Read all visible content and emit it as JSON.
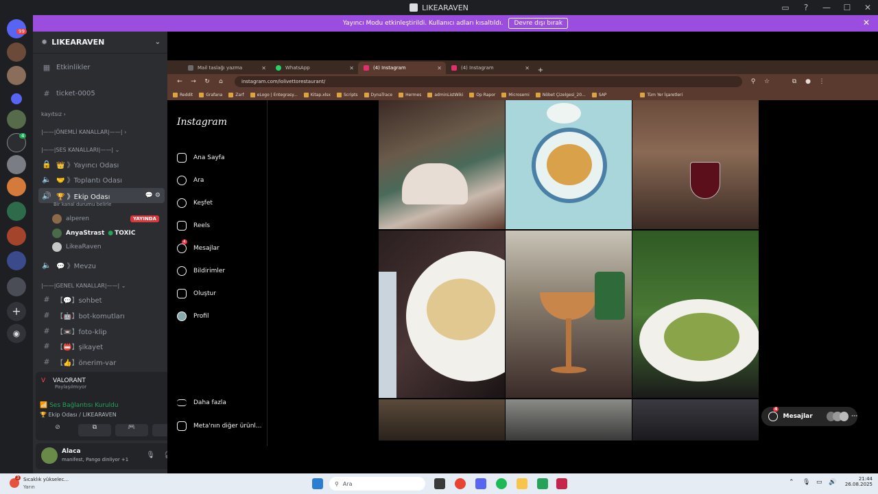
{
  "window": {
    "title": "LIKEARAVEN",
    "controls": [
      "—",
      "☐",
      "✕"
    ]
  },
  "stream_banner": {
    "text": "Yayıncı Modu etkinleştirildi. Kullanıcı adları kısaltıldı.",
    "button": "Devre dışı bırak"
  },
  "rail": {
    "home_badge": "99",
    "badge2": "4"
  },
  "sidebar": {
    "server_name": "LIKEARAVEN",
    "events": "Etkinlikler",
    "ticket": "ticket-0005",
    "kayitsiz": "kayıtsız",
    "cat_onemli": "|——|ÖNEMLİ KANALLAR|——|",
    "cat_ses": "|——|SES KANALLARI|——|",
    "yayinci": "👑 》Yayıncı Odası",
    "toplanti": "🤝 》Toplantı Odası",
    "ekip": "🏆 》Ekip Odası",
    "ekip_status": "Bir kanal durumu belirle",
    "users": [
      {
        "name": "alperen",
        "live": "YAYINDA"
      },
      {
        "name": "AnyaStrast",
        "tag": "TOXIC"
      },
      {
        "name": "LikeaRaven"
      }
    ],
    "mevzu": "💬 》Mevzu",
    "cat_genel": "|——|GENEL KANALLAR|——|",
    "text_channels": [
      {
        "icon": "#",
        "label": "【💬】sohbet"
      },
      {
        "icon": "#",
        "label": "【🤖】bot-komutları"
      },
      {
        "icon": "#",
        "label": "【📼】foto-klip"
      },
      {
        "icon": "#",
        "label": "【📛】şikayet"
      },
      {
        "icon": "#",
        "label": "【👍】önerim-var"
      }
    ]
  },
  "activity": {
    "game": "VALORANT",
    "sub": "Paylaşılmıyor"
  },
  "voice": {
    "status": "Ses Bağlantısı Kuruldu",
    "channel": "🏆 Ekip Odası / LIKEARAVEN"
  },
  "account": {
    "name": "Alaca",
    "sub": "manifest, Pango dinliyor +1"
  },
  "browser": {
    "tabs": [
      {
        "label": "Mail taslağı yazma",
        "color": "#6b6b6b"
      },
      {
        "label": "WhatsApp",
        "color": "#25d366"
      },
      {
        "label": "(4) Instagram",
        "color": "#e1306c"
      },
      {
        "label": "(4) Instagram",
        "color": "#e1306c"
      }
    ],
    "url": "instagram.com/lolivettorestaurant/",
    "bookmarks": [
      "Reddit",
      "Grafana",
      "Zarf",
      "eLogo | Entegrasy...",
      "Kitap.xlsx",
      "Scripts",
      "DynaTrace",
      "Hermes",
      "adminListWiki",
      "Op Rapor",
      "Microsemi",
      "Nöbet Çizelgesi_20...",
      "SAP"
    ],
    "bookmarks_all": "Tüm Yer İşaretleri"
  },
  "instagram": {
    "logo": "Instagram",
    "nav": [
      {
        "label": "Ana Sayfa",
        "icon": "home-icon"
      },
      {
        "label": "Ara",
        "icon": "search-icon"
      },
      {
        "label": "Keşfet",
        "icon": "compass-icon"
      },
      {
        "label": "Reels",
        "icon": "reels-icon"
      },
      {
        "label": "Mesajlar",
        "icon": "messenger-icon",
        "badge": "4"
      },
      {
        "label": "Bildirimler",
        "icon": "heart-icon"
      },
      {
        "label": "Oluştur",
        "icon": "plus-icon"
      },
      {
        "label": "Profil",
        "icon": "avatar-icon"
      }
    ],
    "more": "Daha fazla",
    "meta": "Meta'nın diğer ürünl...",
    "messages_pill": "Mesajlar",
    "messages_badge": "4"
  },
  "taskbar": {
    "weather_title": "Sıcaklık yükselec...",
    "weather_sub": "Yarın",
    "weather_badge": "3",
    "search": "Ara",
    "time": "21:44",
    "date": "26.08.2025"
  }
}
